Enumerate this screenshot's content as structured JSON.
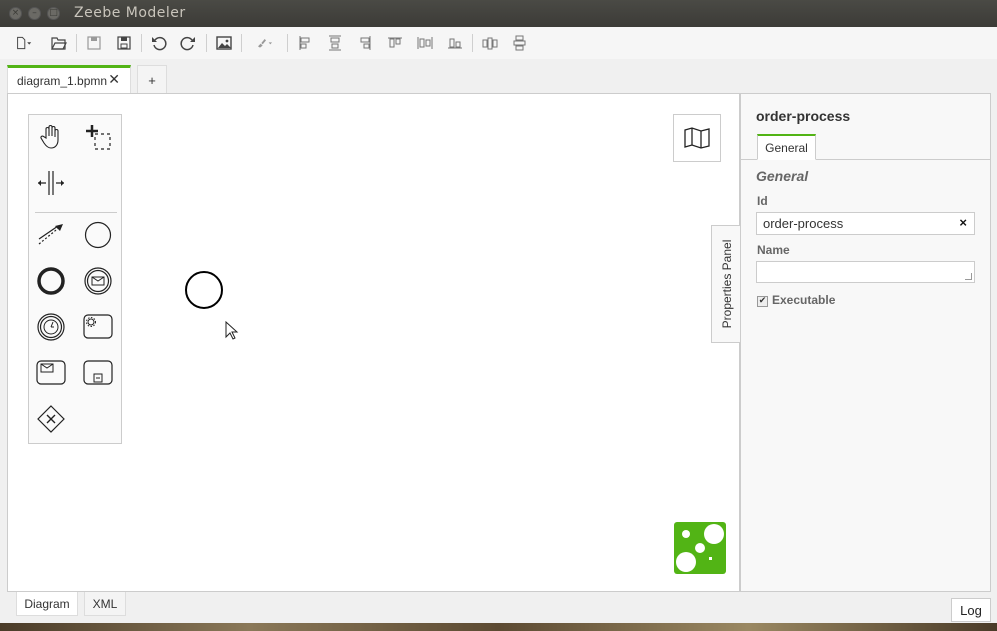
{
  "window": {
    "title": "Zeebe Modeler",
    "close_glyph": "×",
    "min_glyph": "–",
    "max_glyph": "□"
  },
  "toolbar": {
    "buttons": [
      {
        "name": "new-file-icon"
      },
      {
        "name": "open-folder-icon"
      },
      {
        "name": "save-icon"
      },
      {
        "name": "save-as-icon"
      },
      {
        "name": "undo-icon"
      },
      {
        "name": "redo-icon"
      },
      {
        "name": "export-image-icon"
      },
      {
        "name": "color-brush-icon"
      },
      {
        "name": "align-left-icon"
      },
      {
        "name": "align-center-icon"
      },
      {
        "name": "align-right-icon"
      },
      {
        "name": "align-top-icon"
      },
      {
        "name": "align-middle-icon"
      },
      {
        "name": "align-bottom-icon"
      },
      {
        "name": "distribute-horizontal-icon"
      },
      {
        "name": "distribute-vertical-icon"
      }
    ]
  },
  "tabs": {
    "active_label": "diagram_1.bpmn",
    "close_glyph": "✕",
    "add_label": "+"
  },
  "canvas": {
    "props_toggle_label": "Properties Panel",
    "palette": [
      "hand-tool-icon",
      "lasso-tool-icon",
      "space-tool-icon",
      "connect-tool-icon",
      "start-event-icon",
      "end-event-icon",
      "message-intermediate-event-icon",
      "timer-intermediate-event-icon",
      "service-task-icon",
      "receive-task-icon",
      "subprocess-icon",
      "exclusive-gateway-icon"
    ]
  },
  "properties": {
    "title": "order-process",
    "tab_label": "General",
    "group_label": "General",
    "id_label": "Id",
    "id_value": "order-process",
    "clear_glyph": "×",
    "name_label": "Name",
    "name_value": "",
    "executable_label": "Executable",
    "executable_checked": true,
    "check_glyph": "✔"
  },
  "bottom": {
    "diagram_tab": "Diagram",
    "xml_tab": "XML",
    "log_label": "Log"
  },
  "colors": {
    "accent": "#52b415",
    "logo": "#52b415"
  }
}
